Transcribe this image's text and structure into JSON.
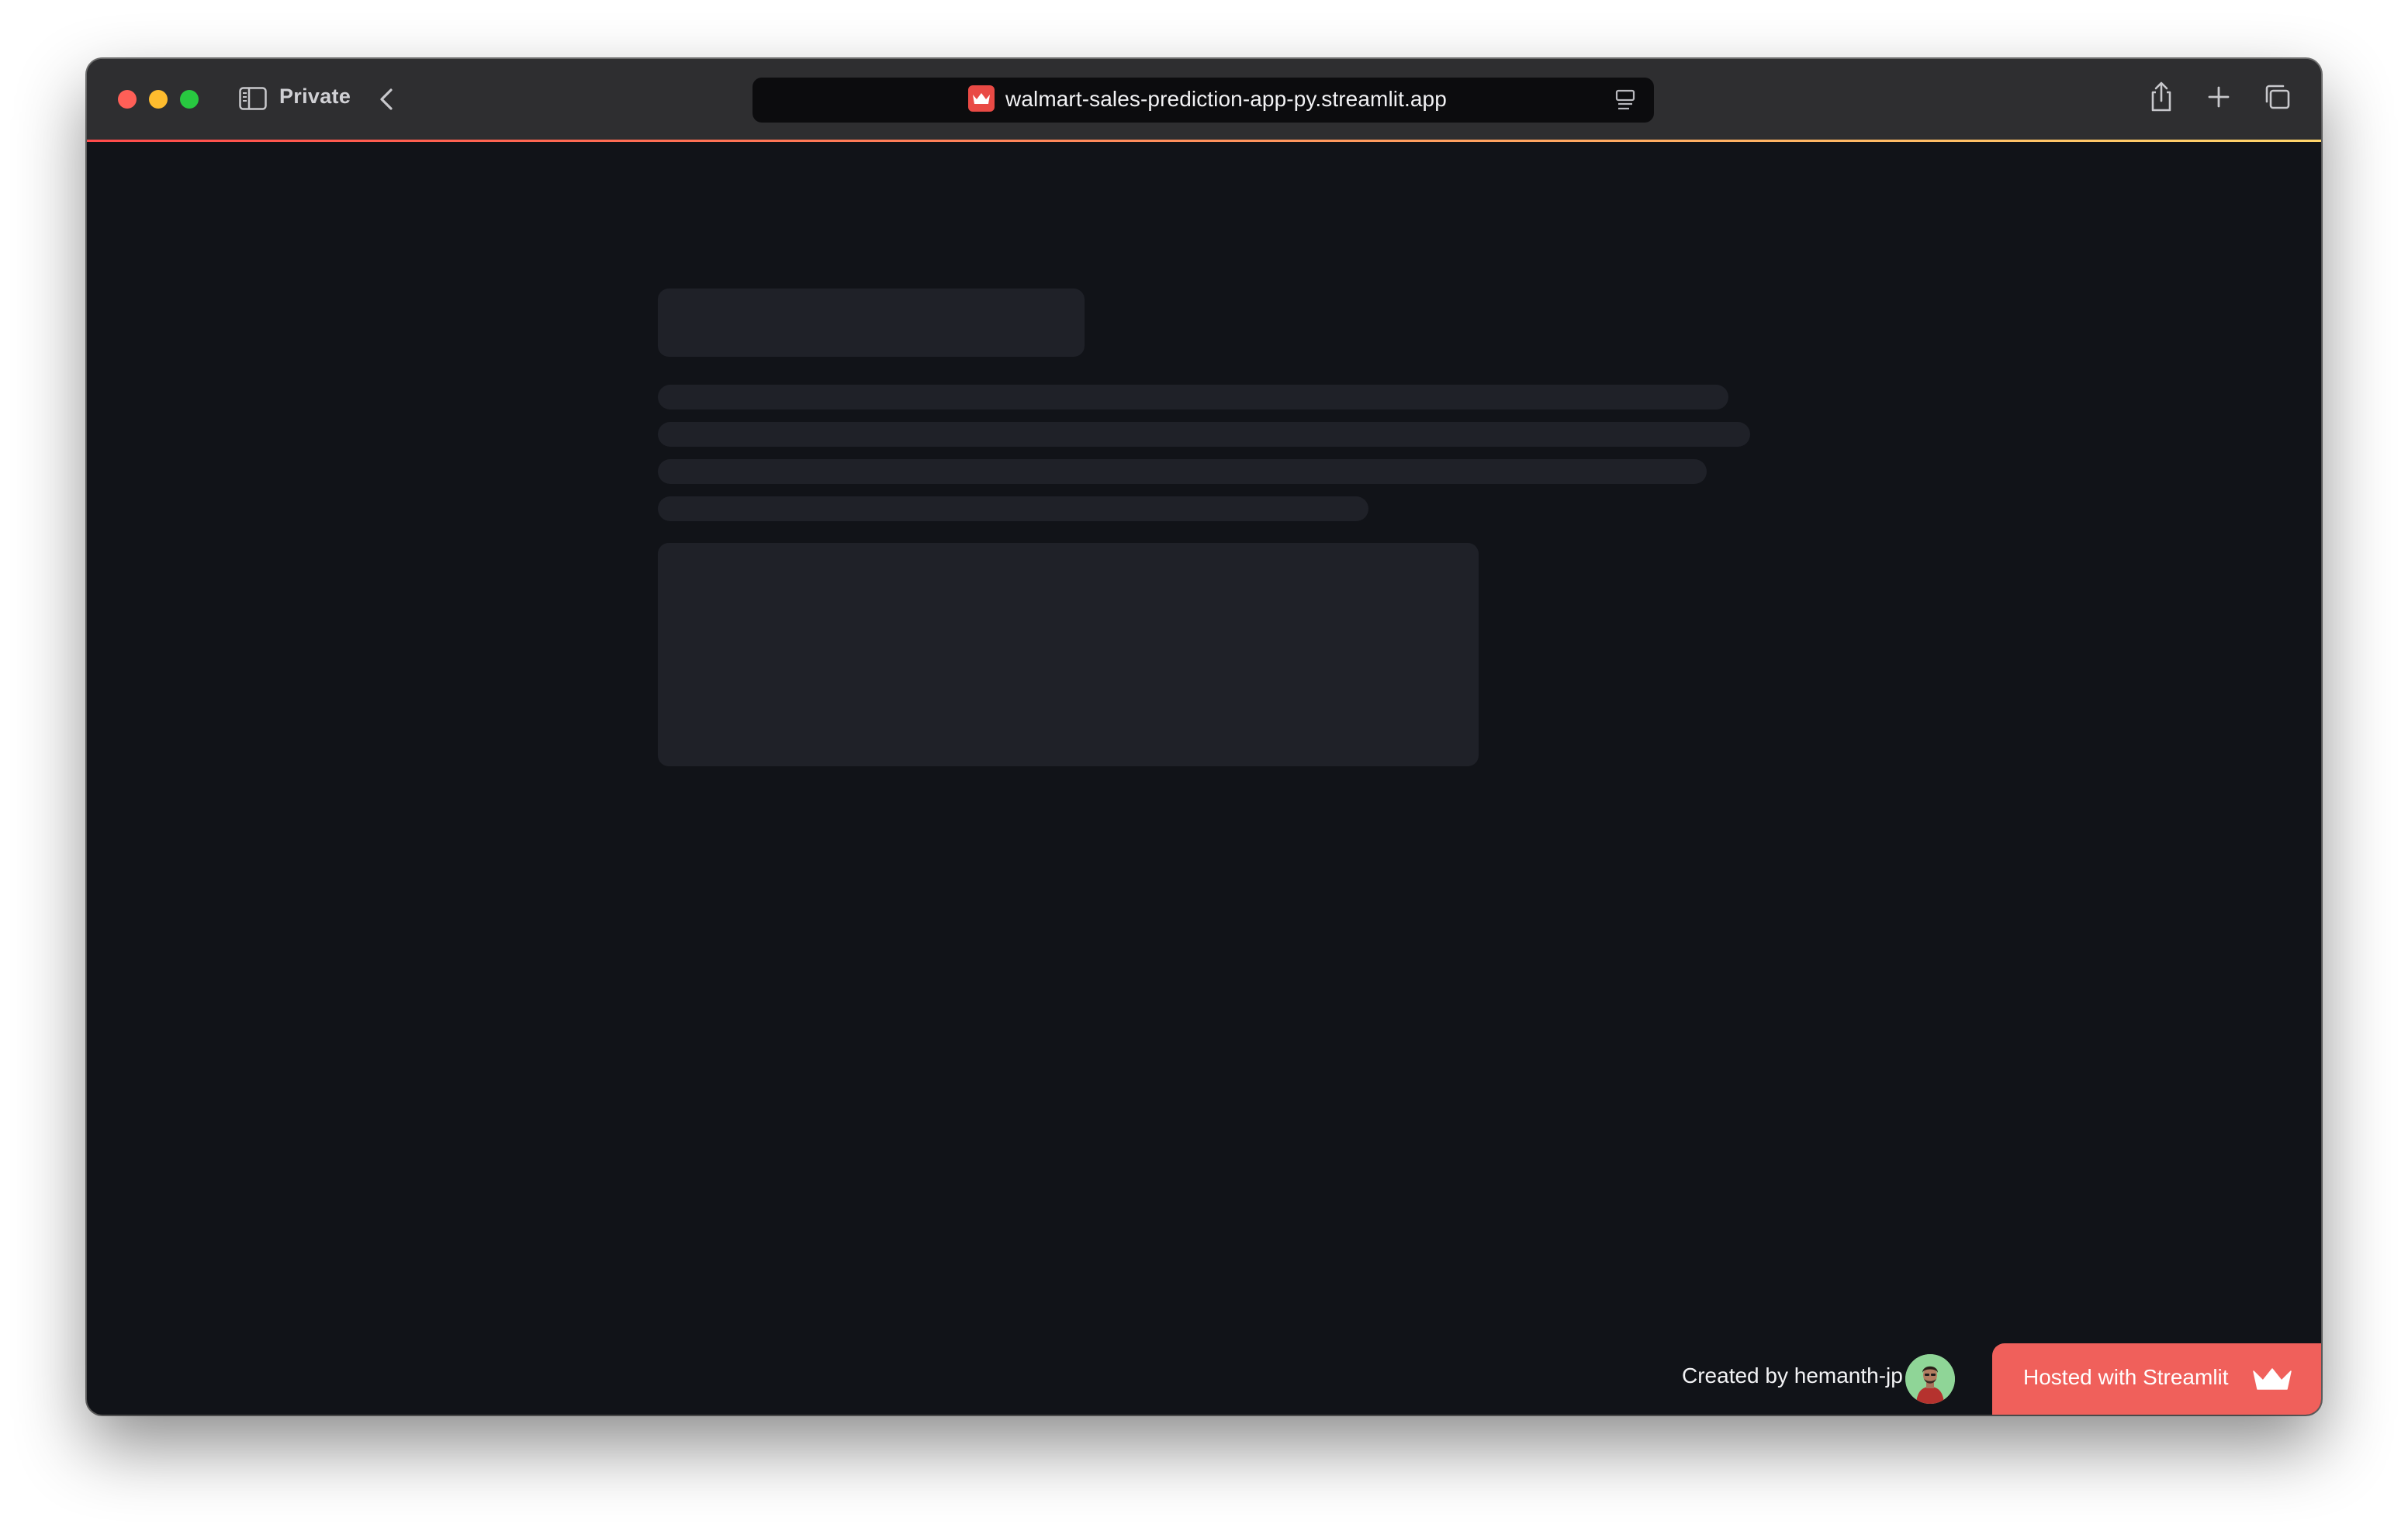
{
  "browser": {
    "mode_label": "Private",
    "url": "walmart-sales-prediction-app-py.streamlit.app",
    "icons": {
      "sidebar": "sidebar-icon",
      "back": "chevron-left-icon",
      "favicon": "streamlit-favicon",
      "reader": "reader-mode-icon",
      "share": "share-icon",
      "new_tab": "plus-icon",
      "tabs": "tab-overview-icon"
    }
  },
  "app": {
    "state": "loading",
    "skeleton_lines": 4
  },
  "footer": {
    "created_by": "Created by hemanth-jp",
    "hosted_label": "Hosted with Streamlit",
    "icons": {
      "avatar": "creator-avatar",
      "crown": "streamlit-crown-icon"
    }
  },
  "colors": {
    "app_background": "#111318",
    "skeleton": "#1f2128",
    "titlebar": "#2e2e30",
    "hosted_badge": "#f0605b"
  }
}
